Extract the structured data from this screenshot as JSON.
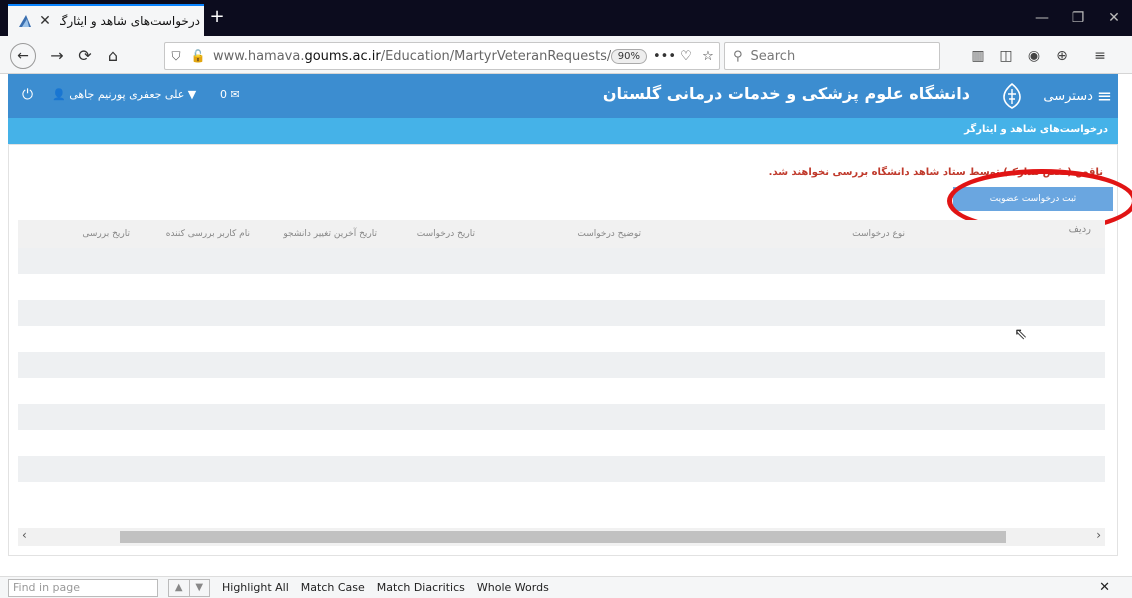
{
  "browser": {
    "tab_title": "درخواست‌های شاهد و ایثارگر",
    "tab_close": "✕",
    "new_tab": "+",
    "url_prefix": "www.hamava.",
    "url_domain": "goums.ac.ir",
    "url_path": "/Education/MartyrVeteranRequests/MartyrV",
    "zoom": "90%",
    "page_actions": "•••",
    "search_placeholder": "Search"
  },
  "header": {
    "university": "دانشگاه علوم پزشکی و خدمات درمانی گلستان",
    "access_label": "دسترسی",
    "user_name": "علی جعفری پورنیم جاهی",
    "mail_count": "0"
  },
  "breadcrumb": {
    "label": "درخواست‌های شاهد و ایثارگر"
  },
  "main": {
    "warning": "ناقص (نقص مدارک) توسط ستاد شاهد دانشگاه بررسی نخواهند شد.",
    "register_button": "ثبت درخواست عضویت",
    "columns": [
      "ردیف",
      "نوع درخواست",
      "توضیح درخواست",
      "تاریخ درخواست",
      "تاریخ آخرین تغییر دانشجو",
      "نام کاربر بررسی کننده",
      "تاریخ بررسی"
    ]
  },
  "findbar": {
    "placeholder": "Find in page",
    "highlight_all": "Highlight All",
    "match_case": "Match Case",
    "match_diacritics": "Match Diacritics",
    "whole_words": "Whole Words"
  },
  "colors": {
    "header_blue": "#3c8dd0",
    "breadcrumb_blue": "#45b2e8",
    "button_blue": "#6aa6e0",
    "warning_red": "#c0392b",
    "annotation_red": "#e11414"
  }
}
